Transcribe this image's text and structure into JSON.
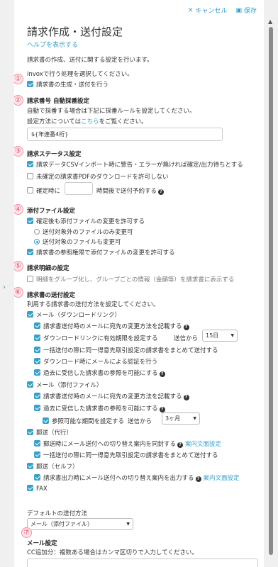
{
  "toolbar": {
    "cancel_label": "キャンセル",
    "save_label": "保存"
  },
  "page": {
    "title": "請求作成・送付設定",
    "help_link": "ヘルプを表示する",
    "description": "請求書の作成、送付に関する設定を行います。"
  },
  "sections": [
    {
      "number": "①",
      "intro": "invoxで行う処理を選択してください。",
      "option": "請求書の生成・送付を行う"
    },
    {
      "number": "②",
      "heading": "請求番号 自動採番設定",
      "line1": "自動で採番する場合は下記に採番ルールを設定してください。",
      "line2_prefix": "設定方法については",
      "line2_link": "こちら",
      "line2_suffix": "をご覧ください。",
      "input_value": "${年連番4桁}"
    },
    {
      "number": "③",
      "heading": "請求ステータス設定",
      "opt1": "請求データCSVインポート時に警告・エラーが無ければ確定/出力待ちとする",
      "opt2": "未確定の請求書PDFのダウンロードを許可しない",
      "opt3_prefix": "確定時に",
      "opt3_suffix": "時間後で送付予約する"
    },
    {
      "number": "④",
      "heading": "添付ファイル設定",
      "opt1": "確定後も添付ファイルの変更を許可する",
      "radio1": "送付対象外のファイルのみ変更可",
      "radio2": "送付対象のファイルも変更可",
      "opt2": "請求書の参照権限で添付ファイルの変更を許可する"
    },
    {
      "number": "⑤",
      "heading": "請求明細の設定",
      "opt1": "明細をグループ化し、グループごとの情報（金額等）を請求書に表示する"
    },
    {
      "number": "⑥",
      "heading": "請求書の送付設定",
      "intro": "利用する請求書の送付方法を設定してください。"
    },
    {
      "number": "⑦",
      "heading": "メール設定",
      "intro": "CC追加分：複数ある場合はカンマ区切りで入力してください。"
    }
  ],
  "delivery": {
    "email_download": {
      "label": "メール（ダウンロードリンク）",
      "opt1": "請求書送付時のメールに宛先の変更方法を記載する",
      "opt2": "ダウンロードリンクに有効期限を設定する",
      "opt2_from": "送信から",
      "opt2_select": "15日",
      "opt3": "一括送付の際に同一得意先取引設定の請求書をまとめて送付する",
      "opt4": "ダウンロード時にメールによる認証を行う",
      "opt5": "過去に受信した請求書の参照を可能にする"
    },
    "email_attach": {
      "label": "メール（添付ファイル）",
      "opt1": "請求書送付時のメールに宛先の変更方法を記載する",
      "opt2": "過去に受信した請求書の参照を可能にする",
      "opt3": "参照可能な期間を設定する",
      "opt3_from": "送信から",
      "opt3_select": "3ヶ月"
    },
    "post_agent": {
      "label": "郵送（代行）",
      "opt1": "郵送時にメール送付への切り替え案内を同封する",
      "opt1_link": "案内文面設定",
      "opt2": "一括送付の際に同一得意先取引設定の請求書をまとめて送付する"
    },
    "post_self": {
      "label": "郵送（セルフ）",
      "opt1": "請求書出力時にメール送付への切り替え案内を出力する",
      "opt1_link": "案内文面設定"
    },
    "fax": {
      "label": "FAX"
    },
    "default_label": "デフォルトの送付方法",
    "default_value": "メール（添付ファイル）"
  },
  "icons": {
    "cancel": "close-icon",
    "save": "save-icon",
    "help": "question-icon"
  },
  "colors": {
    "accent": "#3aa0c8",
    "badge": "#e0466a"
  }
}
